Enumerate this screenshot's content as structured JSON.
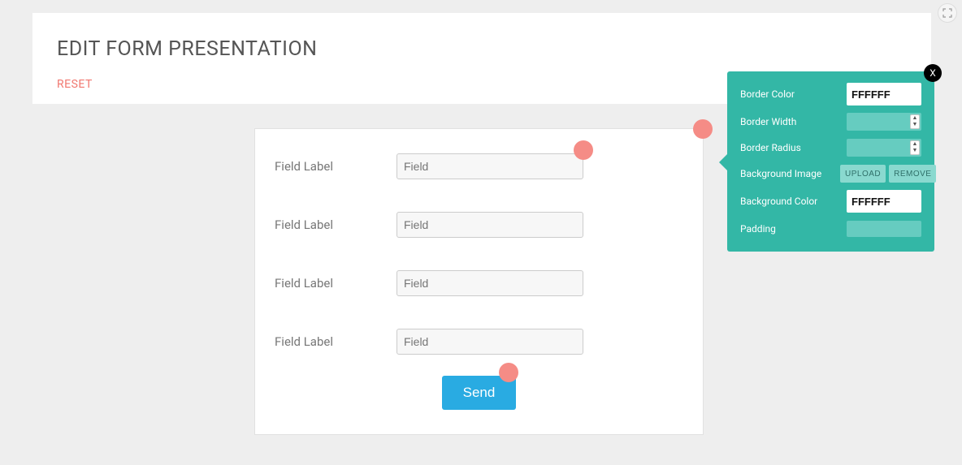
{
  "header": {
    "title": "EDIT FORM PRESENTATION",
    "reset_label": "RESET"
  },
  "form": {
    "fields": [
      {
        "label": "Field Label",
        "placeholder": "Field",
        "value": ""
      },
      {
        "label": "Field Label",
        "placeholder": "Field",
        "value": ""
      },
      {
        "label": "Field Label",
        "placeholder": "Field",
        "value": ""
      },
      {
        "label": "Field Label",
        "placeholder": "Field",
        "value": ""
      }
    ],
    "submit_label": "Send"
  },
  "properties": {
    "close_label": "X",
    "border_color": {
      "label": "Border Color",
      "value": "FFFFFF"
    },
    "border_width": {
      "label": "Border Width",
      "value": ""
    },
    "border_radius": {
      "label": "Border Radius",
      "value": ""
    },
    "bg_image": {
      "label": "Background Image",
      "upload_label": "UPLOAD",
      "remove_label": "REMOVE"
    },
    "bg_color": {
      "label": "Background Color",
      "value": "FFFFFF"
    },
    "padding": {
      "label": "Padding",
      "value": ""
    }
  },
  "colors": {
    "accent": "#f1776f",
    "teal": "#33b7a6",
    "blue": "#29abe2"
  }
}
